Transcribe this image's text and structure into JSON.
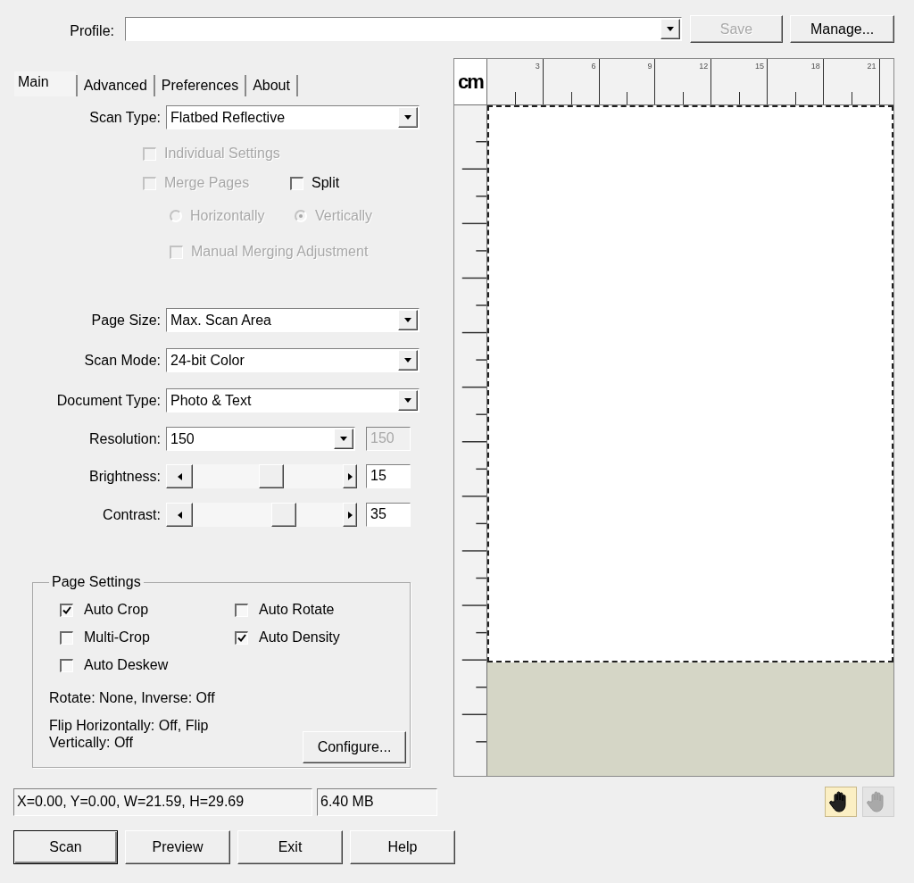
{
  "profile": {
    "label": "Profile:"
  },
  "header_buttons": [
    {
      "label": "Save",
      "disabled": true
    },
    {
      "label": "Manage...",
      "disabled": false
    }
  ],
  "tabs": [
    {
      "label": "Main",
      "selected": true
    },
    {
      "label": "Advanced",
      "selected": false
    },
    {
      "label": "Preferences",
      "selected": false
    },
    {
      "label": "About",
      "selected": false
    }
  ],
  "scan_type": {
    "label": "Scan Type:",
    "value": "Flatbed Reflective"
  },
  "option_rows": [
    [
      {
        "kind": "checkbox",
        "label": "Individual Settings",
        "checked": false,
        "disabled": true
      }
    ],
    [
      {
        "kind": "checkbox",
        "label": "Merge Pages",
        "checked": false,
        "disabled": true
      },
      {
        "kind": "checkbox",
        "label": "Split",
        "checked": false,
        "disabled": false
      }
    ],
    [
      {
        "kind": "radio",
        "label": "Horizontally",
        "selected": false,
        "disabled": true
      },
      {
        "kind": "radio",
        "label": "Vertically",
        "selected": true,
        "disabled": true
      }
    ],
    [
      {
        "kind": "checkbox",
        "label": "Manual Merging Adjustment",
        "checked": false,
        "disabled": true
      }
    ]
  ],
  "settings": [
    {
      "kind": "dropdown",
      "label": "Page Size:",
      "value": "Max. Scan Area"
    },
    {
      "kind": "dropdown",
      "label": "Scan Mode:",
      "value": "24-bit Color"
    },
    {
      "kind": "dropdown",
      "label": "Document Type:",
      "value": "Photo & Text"
    },
    {
      "kind": "dropdown",
      "label": "Resolution:",
      "value": "150",
      "field": {
        "value": "150",
        "disabled": true
      }
    },
    {
      "kind": "slider",
      "label": "Brightness:",
      "level": 0.53,
      "field": {
        "value": "15",
        "disabled": false
      }
    },
    {
      "kind": "slider",
      "label": "Contrast:",
      "level": 0.63,
      "field": {
        "value": "35",
        "disabled": false
      }
    }
  ],
  "page_settings": {
    "title": "Page Settings",
    "checkboxes": [
      {
        "label": "Auto Crop",
        "checked": true
      },
      {
        "label": "Auto Rotate",
        "checked": false
      },
      {
        "label": "Multi-Crop",
        "checked": false
      },
      {
        "label": "Auto Density",
        "checked": true
      },
      {
        "label": "Auto Deskew",
        "checked": false
      }
    ],
    "summary": [
      "Rotate: None, Inverse: Off",
      "Flip Horizontally: Off, Flip Vertically: Off"
    ],
    "button": "Configure..."
  },
  "preview": {
    "unit": "cm",
    "ruler_labels": [
      "3",
      "6",
      "9",
      "12",
      "15",
      "18",
      "21"
    ]
  },
  "status": {
    "coordinates": "X=0.00, Y=0.00, W=21.59, H=29.69",
    "size": "6.40 MB"
  },
  "tools": [
    {
      "selected": true
    },
    {
      "selected": false
    }
  ],
  "buttons": [
    {
      "label": "Scan",
      "default": true
    },
    {
      "label": "Preview",
      "default": false
    },
    {
      "label": "Exit",
      "default": false
    },
    {
      "label": "Help",
      "default": false
    }
  ]
}
